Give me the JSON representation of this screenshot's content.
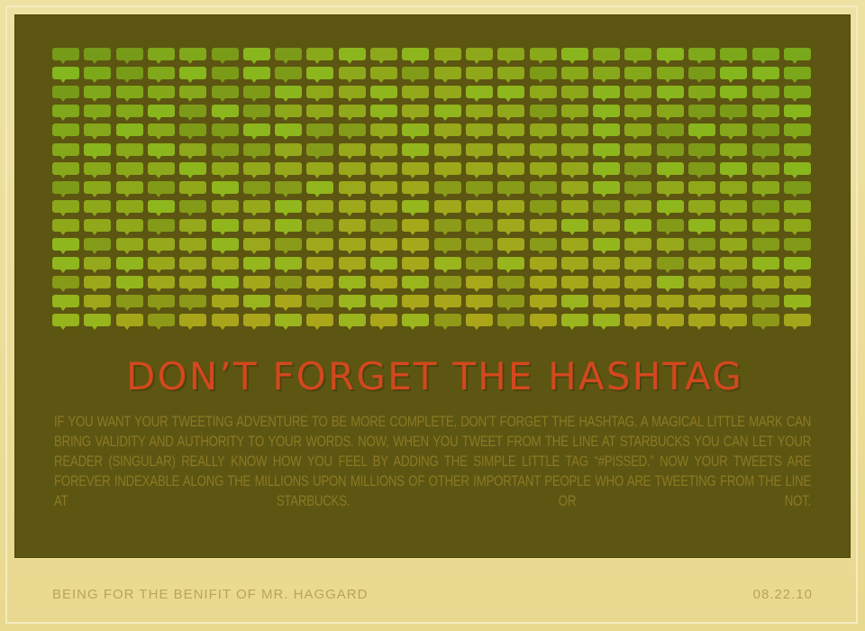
{
  "poster": {
    "headline": "DON’T FORGET THE HASHTAG",
    "body": "If you want your tweeting adventure to be more complete, don’t forget the hashtag. A magical little mark can bring validity and authority to your words. Now, when you tweet from the line at Starbucks you can let your reader (singular) really know how you feel by adding the simple little tag “#pissed.” Now your tweets are forever indexable along the millions upon millions of other important people who are tweeting from the line at Starbucks. Or not.",
    "footer_left": "BEING FOR THE BENIFIT OF MR. HAGGARD",
    "footer_right": "08.22.10"
  },
  "grid": {
    "icon": "speech-bubble-icon",
    "columns": 24,
    "rows": 15,
    "colors": {
      "panel": "#5d5512",
      "bright": "#86b81f",
      "mid": "#7aa31c",
      "dim": "#9aa41a",
      "olive": "#a6a419",
      "headline": "#d2481e",
      "body": "#8a7a24",
      "footer": "#bba35a",
      "frame": "#ecdc98"
    }
  }
}
